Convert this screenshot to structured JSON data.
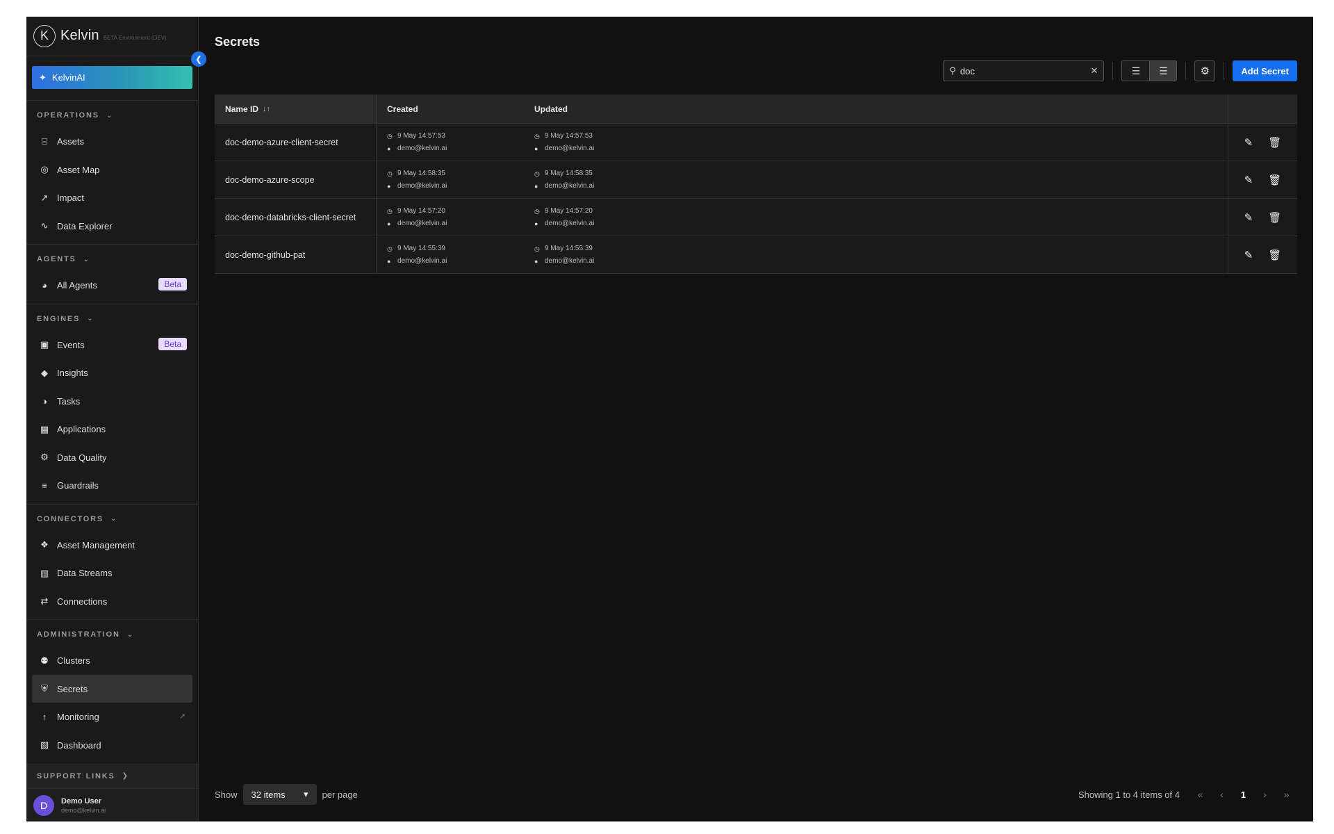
{
  "brand": {
    "name": "Kelvin",
    "env": "BETA Environment (DEV)",
    "logo_letter": "K"
  },
  "kelvin_ai": {
    "label": "KelvinAI"
  },
  "sidebar": {
    "sections": [
      {
        "title": "OPERATIONS",
        "items": [
          {
            "label": "Assets",
            "icon": "assets-icon"
          },
          {
            "label": "Asset Map",
            "icon": "globe-icon"
          },
          {
            "label": "Impact",
            "icon": "impact-icon"
          },
          {
            "label": "Data Explorer",
            "icon": "pulse-icon"
          }
        ]
      },
      {
        "title": "AGENTS",
        "items": [
          {
            "label": "All Agents",
            "icon": "agent-icon",
            "badge": "Beta"
          }
        ]
      },
      {
        "title": "ENGINES",
        "items": [
          {
            "label": "Events",
            "icon": "events-icon",
            "badge": "Beta"
          },
          {
            "label": "Insights",
            "icon": "tag-icon"
          },
          {
            "label": "Tasks",
            "icon": "tasks-icon"
          },
          {
            "label": "Applications",
            "icon": "apps-icon"
          },
          {
            "label": "Data Quality",
            "icon": "gear-icon"
          },
          {
            "label": "Guardrails",
            "icon": "barrier-icon"
          }
        ]
      },
      {
        "title": "CONNECTORS",
        "items": [
          {
            "label": "Asset Management",
            "icon": "asset-mgmt-icon"
          },
          {
            "label": "Data Streams",
            "icon": "streams-icon"
          },
          {
            "label": "Connections",
            "icon": "connections-icon"
          }
        ]
      },
      {
        "title": "ADMINISTRATION",
        "items": [
          {
            "label": "Clusters",
            "icon": "clusters-icon"
          },
          {
            "label": "Secrets",
            "icon": "shield-icon",
            "active": true
          },
          {
            "label": "Monitoring",
            "icon": "chart-icon",
            "external": true
          },
          {
            "label": "Dashboard",
            "icon": "dashboard-icon"
          }
        ]
      }
    ],
    "support_label": "SUPPORT LINKS",
    "user": {
      "initial": "D",
      "name": "Demo User",
      "email": "demo@kelvin.ai"
    }
  },
  "page": {
    "title": "Secrets"
  },
  "toolbar": {
    "search_value": "doc",
    "search_placeholder": "Search",
    "add_label": "Add Secret"
  },
  "table": {
    "headers": {
      "name": "Name ID",
      "created": "Created",
      "updated": "Updated"
    },
    "rows": [
      {
        "name": "doc-demo-azure-client-secret",
        "created_time": "9 May 14:57:53",
        "created_by": "demo@kelvin.ai",
        "updated_time": "9 May 14:57:53",
        "updated_by": "demo@kelvin.ai"
      },
      {
        "name": "doc-demo-azure-scope",
        "created_time": "9 May 14:58:35",
        "created_by": "demo@kelvin.ai",
        "updated_time": "9 May 14:58:35",
        "updated_by": "demo@kelvin.ai"
      },
      {
        "name": "doc-demo-databricks-client-secret",
        "created_time": "9 May 14:57:20",
        "created_by": "demo@kelvin.ai",
        "updated_time": "9 May 14:57:20",
        "updated_by": "demo@kelvin.ai"
      },
      {
        "name": "doc-demo-github-pat",
        "created_time": "9 May 14:55:39",
        "created_by": "demo@kelvin.ai",
        "updated_time": "9 May 14:55:39",
        "updated_by": "demo@kelvin.ai"
      }
    ]
  },
  "footer": {
    "show_label": "Show",
    "page_size": "32 items",
    "per_page_label": "per page",
    "showing": "Showing 1 to 4 items of 4",
    "current_page": "1"
  }
}
